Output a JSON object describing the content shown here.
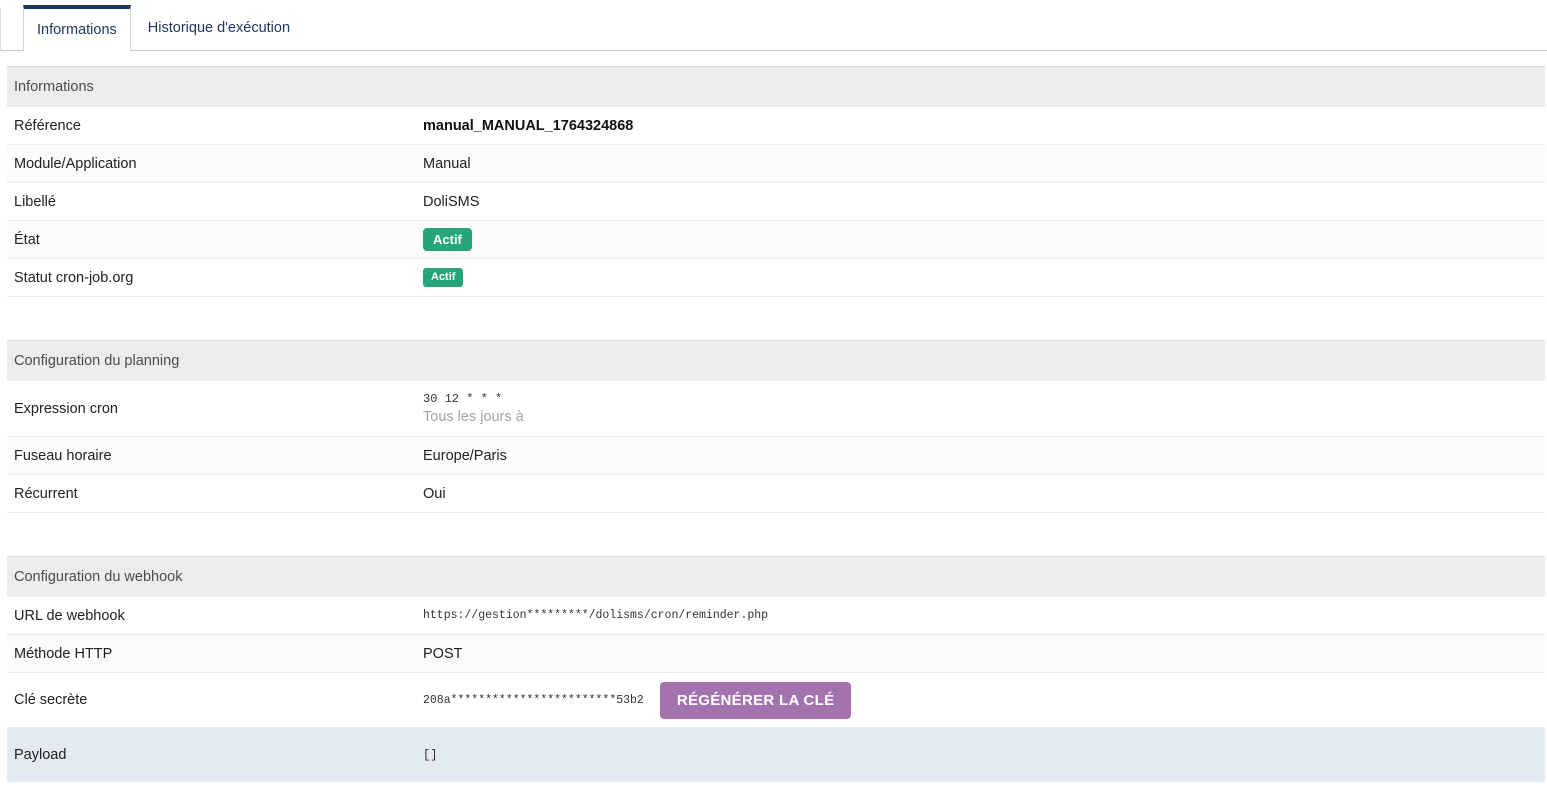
{
  "colors": {
    "tab_navy": "#1d3765",
    "badge_active": "#26a57c",
    "button_purple": "#a472af",
    "payload_bg": "#e4eaf3"
  },
  "tabs": {
    "informations": "Informations",
    "historique": "Historique d'exécution"
  },
  "info": {
    "header": "Informations",
    "rows": {
      "reference": {
        "label": "Référence",
        "value": "manual_MANUAL_1764324868"
      },
      "module": {
        "label": "Module/Application",
        "value": "Manual"
      },
      "libelle": {
        "label": "Libellé",
        "value": "DoliSMS"
      },
      "etat": {
        "label": "État",
        "value": "Actif"
      },
      "cronjob_status": {
        "label": "Statut cron-job.org",
        "value": "Actif"
      }
    }
  },
  "planning": {
    "header": "Configuration du planning",
    "rows": {
      "cron": {
        "label": "Expression cron",
        "expression": "30 12 * * *",
        "description": "Tous les jours à"
      },
      "timezone": {
        "label": "Fuseau horaire",
        "value": "Europe/Paris"
      },
      "recurrent": {
        "label": "Récurrent",
        "value": "Oui"
      }
    }
  },
  "webhook": {
    "header": "Configuration du webhook",
    "rows": {
      "url": {
        "label": "URL de webhook",
        "value": "https://gestion*********/dolisms/cron/reminder.php"
      },
      "method": {
        "label": "Méthode HTTP",
        "value": "POST"
      },
      "secret": {
        "label": "Clé secrète",
        "value": "208a************************53b2",
        "button": "RÉGÉNÉRER LA CLÉ"
      },
      "payload": {
        "label": "Payload",
        "value": "[]"
      }
    }
  }
}
